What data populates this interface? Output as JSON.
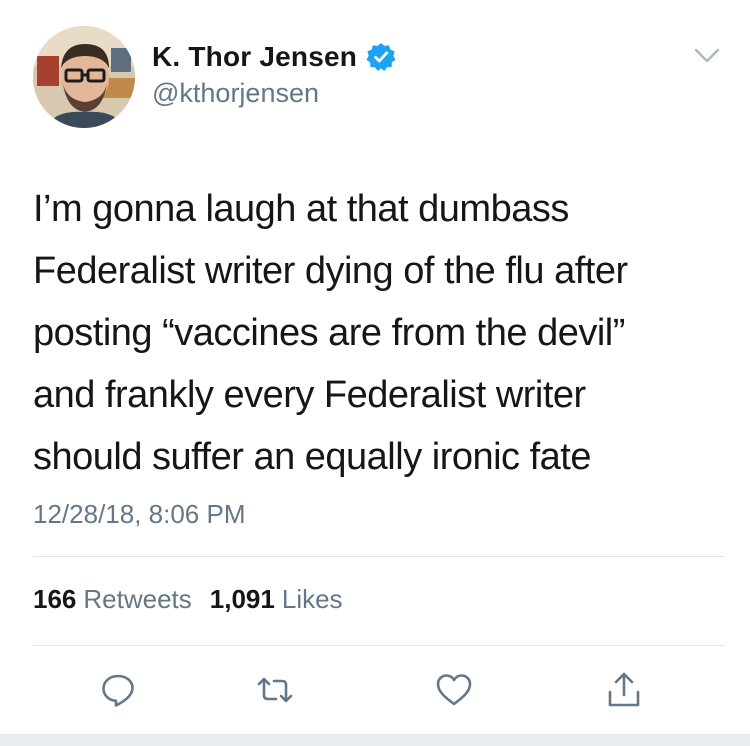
{
  "tweet": {
    "author": {
      "display_name": "K. Thor Jensen",
      "handle": "@kthorjensen",
      "verified": true
    },
    "text": "I’m gonna laugh at that dumbass\nFederalist writer dying of the flu after\nposting “vaccines are from the devil”\nand frankly every Federalist writer\nshould suffer an equally ironic fate",
    "timestamp": "12/28/18, 8:06 PM",
    "stats": {
      "retweets_count": "166",
      "retweets_label": "Retweets",
      "likes_count": "1,091",
      "likes_label": "Likes"
    },
    "actions": [
      {
        "icon": "reply-icon"
      },
      {
        "icon": "retweet-icon"
      },
      {
        "icon": "heart-icon"
      },
      {
        "icon": "share-icon"
      }
    ]
  },
  "colors": {
    "text": "#14171a",
    "secondary": "#657786",
    "verified_blue": "#1da1f2",
    "divider": "#e1e8ed",
    "icon": "#657786"
  }
}
